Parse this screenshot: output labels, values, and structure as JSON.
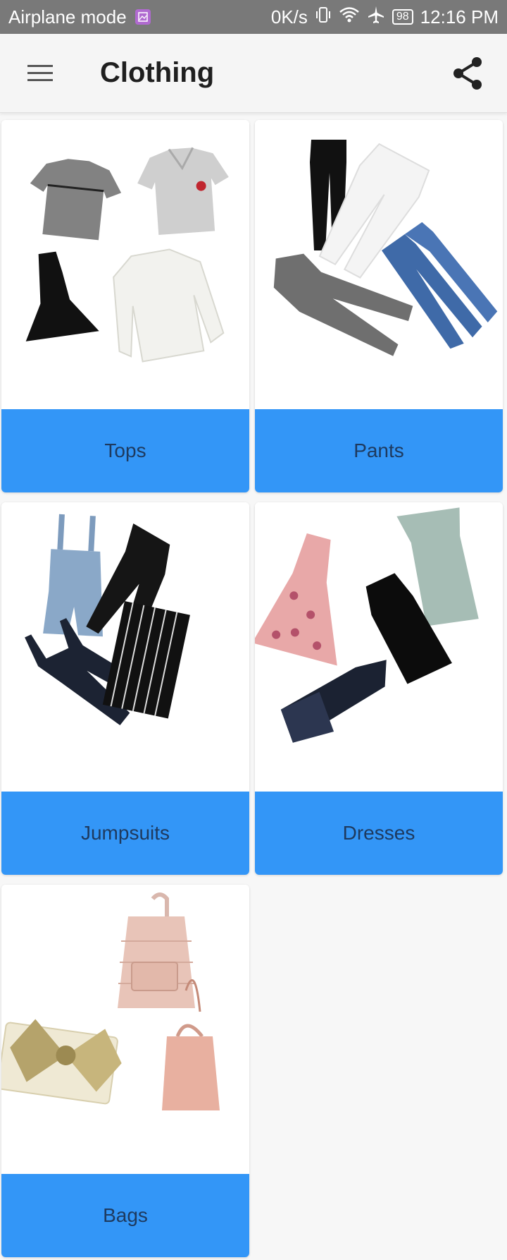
{
  "status_bar": {
    "left_text": "Airplane mode",
    "speed": "0K/s",
    "battery": "98",
    "time": "12:16 PM"
  },
  "app_bar": {
    "title": "Clothing",
    "menu_icon": "hamburger-menu-icon",
    "share_icon": "share-icon"
  },
  "categories": [
    {
      "label": "Tops"
    },
    {
      "label": "Pants"
    },
    {
      "label": "Jumpsuits"
    },
    {
      "label": "Dresses"
    },
    {
      "label": "Bags"
    }
  ],
  "colors": {
    "status_bar_bg": "#797979",
    "app_bar_bg": "#f5f5f5",
    "card_label_bg": "#3396f7",
    "card_label_text": "#1e3a5f",
    "page_bg": "#f7f7f7"
  }
}
